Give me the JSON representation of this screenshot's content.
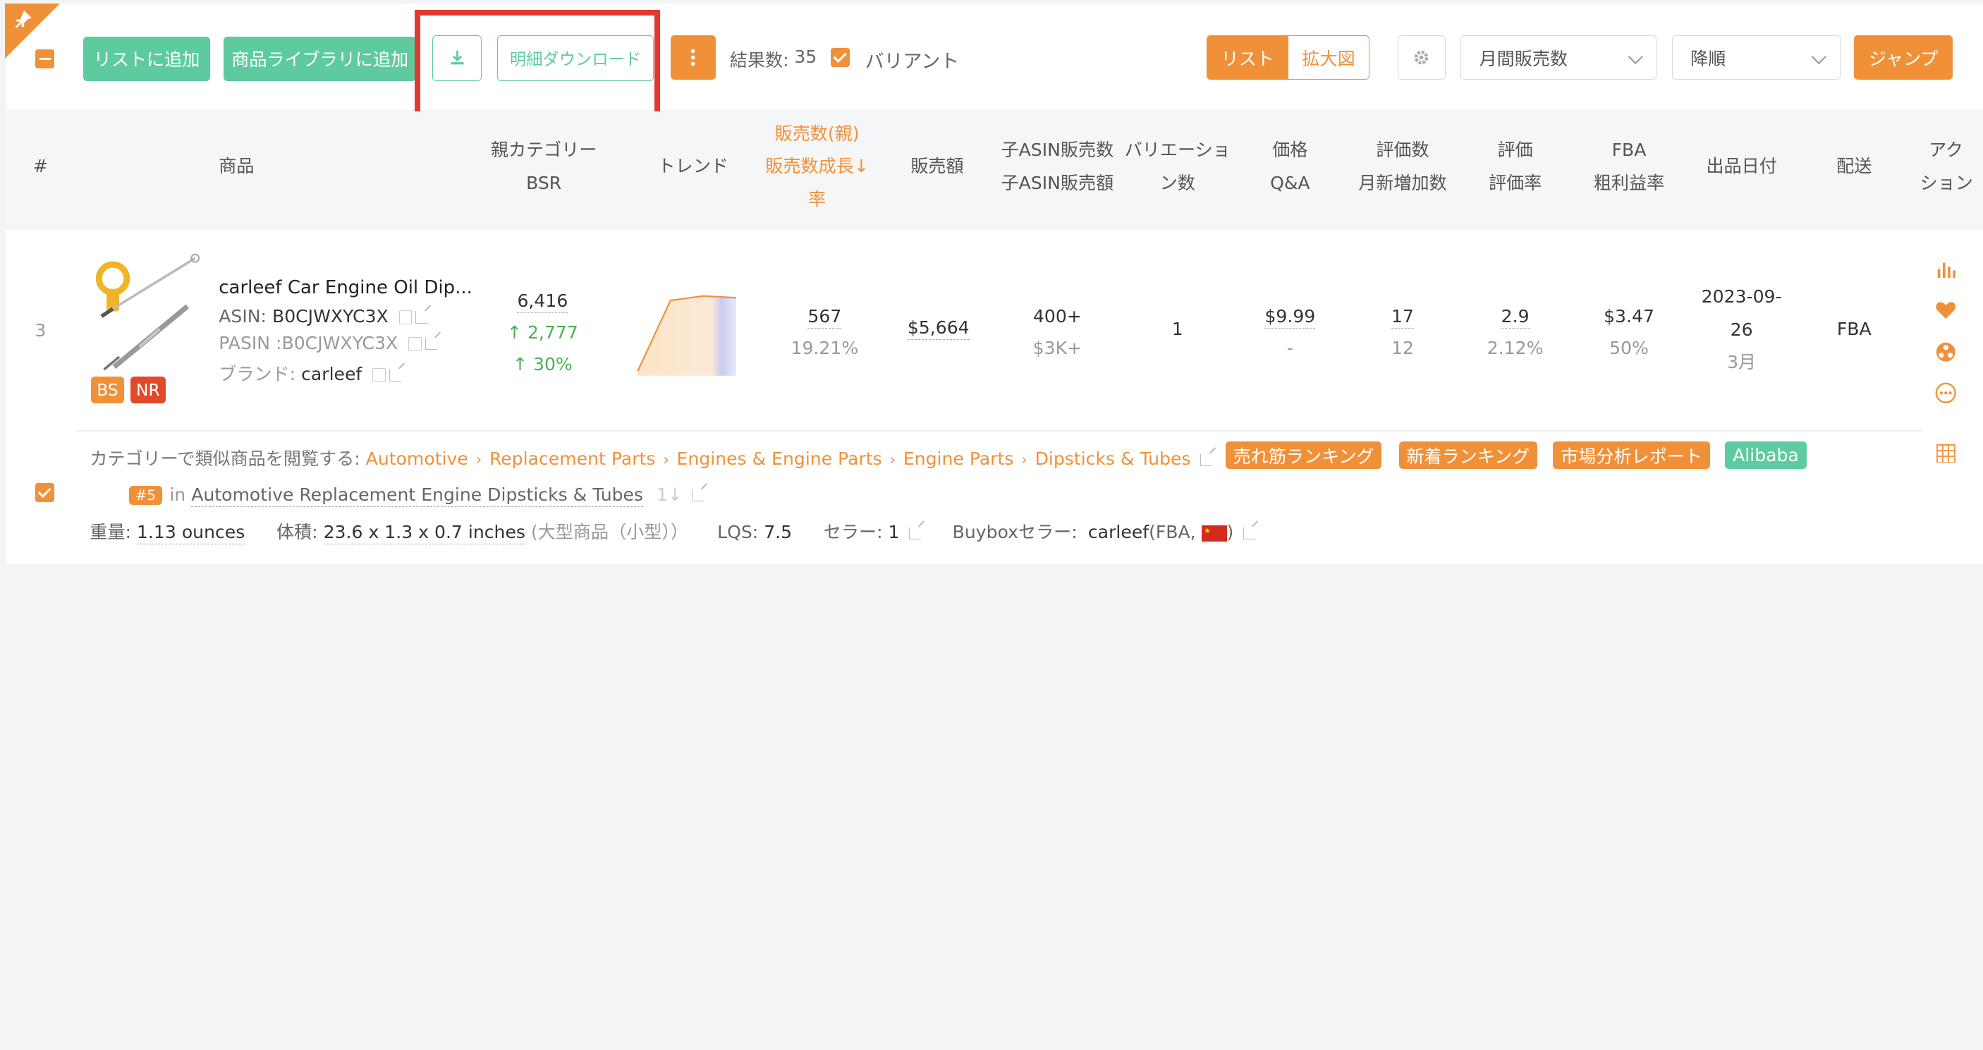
{
  "toolbar": {
    "add_to_list": "リストに追加",
    "add_to_library": "商品ライブラリに追加",
    "detail_download": "明細ダウンロード",
    "results_label": "結果数:",
    "results_count": "35",
    "variant_label": "バリアント",
    "view_list": "リスト",
    "view_zoom": "拡大図",
    "sort_field": "月間販売数",
    "sort_order": "降順",
    "jump": "ジャンプ"
  },
  "columns": {
    "num": "#",
    "product": "商品",
    "parent_category_1": "親カテゴリー",
    "parent_category_2": "BSR",
    "trend": "トレンド",
    "sales_1": "販売数(親)",
    "sales_2": "販売数成長↓",
    "sales_3": "率",
    "revenue": "販売額",
    "child_1": "子ASIN販売数",
    "child_2": "子ASIN販売額",
    "variation_1": "バリエーショ",
    "variation_2": "ン数",
    "price_1": "価格",
    "price_2": "Q&A",
    "reviews_1": "評価数",
    "reviews_2": "月新増加数",
    "rating_1": "評価",
    "rating_2": "評価率",
    "fba_1": "FBA",
    "fba_2": "粗利益率",
    "listing_date": "出品日付",
    "shipping": "配送",
    "action_1": "アク",
    "action_2": "ション"
  },
  "product": {
    "rank": "3",
    "title": "carleef Car Engine Oil Dip...",
    "asin_label": "ASIN:",
    "asin": "B0CJWXYC3X",
    "pasin_label": "PASIN :",
    "pasin": "B0CJWXYC3X",
    "brand_label": "ブランド:",
    "brand": "carleef",
    "badge_bs": "BS",
    "badge_nr": "NR",
    "bsr": "6,416",
    "bsr_up": "↑ 2,777",
    "bsr_pct": "↑ 30%",
    "sales": "567",
    "sales_growth": "19.21%",
    "revenue": "$5,664",
    "child_sales": "400+",
    "child_revenue": "$3K+",
    "variations": "1",
    "price": "$9.99",
    "qa": "-",
    "reviews": "17",
    "reviews_new": "12",
    "rating": "2.9",
    "rating_rate": "2.12%",
    "fba_profit": "$3.47",
    "margin": "50%",
    "date_1": "2023-09-",
    "date_2": "26",
    "date_rel": "3月",
    "shipping": "FBA"
  },
  "detail": {
    "browse_label": "カテゴリーで類似商品を閲覧する:",
    "crumbs": [
      "Automotive",
      "Replacement Parts",
      "Engines & Engine Parts",
      "Engine Parts",
      "Dipsticks & Tubes"
    ],
    "tag_best": "売れ筋ランキング",
    "tag_new": "新着ランキング",
    "tag_market": "市場分析レポート",
    "tag_alibaba": "Alibaba",
    "rank_badge": "#5",
    "rank_in": "in",
    "rank_category": "Automotive Replacement Engine Dipsticks & Tubes",
    "rank_arrows": "1↓",
    "weight_label": "重量:",
    "weight": "1.13 ounces",
    "volume_label": "体積:",
    "volume": "23.6 x 1.3 x 0.7 inches",
    "size_class": "(大型商品（小型））",
    "lqs_label": "LQS:",
    "lqs": "7.5",
    "seller_label": "セラー:",
    "seller": "1",
    "buybox_label": "Buyboxセラー:",
    "buybox_seller": "carleef",
    "buybox_meta": "(FBA,",
    "buybox_close": ")"
  },
  "trend_series": [
    0.05,
    0.85,
    0.9,
    0.88
  ],
  "colors": {
    "accent": "#f0913a",
    "green": "#5ecb9f",
    "highlight_box": "#e03a2f"
  }
}
